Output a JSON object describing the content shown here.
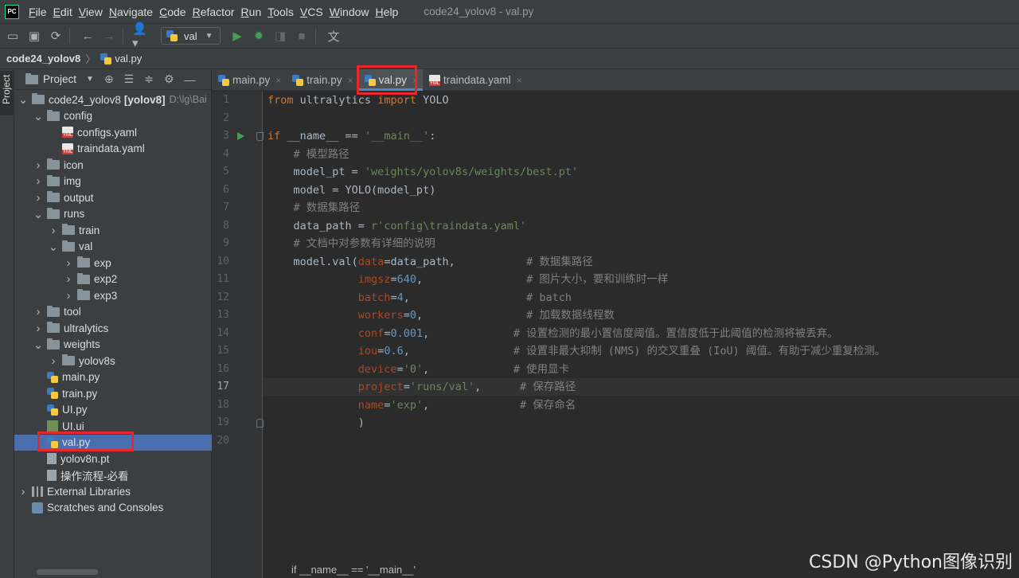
{
  "menubar": {
    "app_icon": "PC",
    "items": [
      "File",
      "Edit",
      "View",
      "Navigate",
      "Code",
      "Refactor",
      "Run",
      "Tools",
      "VCS",
      "Window",
      "Help"
    ],
    "window_title": "code24_yolov8 - val.py"
  },
  "toolbar": {
    "run_config": "val",
    "icons": [
      "open-icon",
      "save-icon",
      "sync-icon",
      "back-icon",
      "forward-icon",
      "user-icon",
      "run-icon",
      "debug-icon",
      "coverage-icon",
      "stop-icon",
      "translate-icon"
    ]
  },
  "breadcrumb": {
    "project": "code24_yolov8",
    "file": "val.py"
  },
  "toolstrip": {
    "project_tab": "Project"
  },
  "project_panel": {
    "title": "Project",
    "tree": [
      {
        "label": "code24_yolov8",
        "suffix": "[yolov8]",
        "path": "D:\\lg\\Bai",
        "type": "folder",
        "indent": 0,
        "arrow": "open"
      },
      {
        "label": "config",
        "type": "folder",
        "indent": 1,
        "arrow": "open"
      },
      {
        "label": "configs.yaml",
        "type": "yaml",
        "indent": 2,
        "arrow": "none"
      },
      {
        "label": "traindata.yaml",
        "type": "yaml",
        "indent": 2,
        "arrow": "none"
      },
      {
        "label": "icon",
        "type": "folder",
        "indent": 1,
        "arrow": "closed"
      },
      {
        "label": "img",
        "type": "folder",
        "indent": 1,
        "arrow": "closed"
      },
      {
        "label": "output",
        "type": "folder",
        "indent": 1,
        "arrow": "closed"
      },
      {
        "label": "runs",
        "type": "folder",
        "indent": 1,
        "arrow": "open"
      },
      {
        "label": "train",
        "type": "folder",
        "indent": 2,
        "arrow": "closed"
      },
      {
        "label": "val",
        "type": "folder",
        "indent": 2,
        "arrow": "open"
      },
      {
        "label": "exp",
        "type": "folder",
        "indent": 3,
        "arrow": "closed"
      },
      {
        "label": "exp2",
        "type": "folder",
        "indent": 3,
        "arrow": "closed"
      },
      {
        "label": "exp3",
        "type": "folder",
        "indent": 3,
        "arrow": "closed"
      },
      {
        "label": "tool",
        "type": "folder",
        "indent": 1,
        "arrow": "closed"
      },
      {
        "label": "ultralytics",
        "type": "folder",
        "indent": 1,
        "arrow": "closed"
      },
      {
        "label": "weights",
        "type": "folder",
        "indent": 1,
        "arrow": "open"
      },
      {
        "label": "yolov8s",
        "type": "folder",
        "indent": 2,
        "arrow": "closed"
      },
      {
        "label": "main.py",
        "type": "python",
        "indent": 1,
        "arrow": "none"
      },
      {
        "label": "train.py",
        "type": "python",
        "indent": 1,
        "arrow": "none"
      },
      {
        "label": "UI.py",
        "type": "python",
        "indent": 1,
        "arrow": "none"
      },
      {
        "label": "UI.ui",
        "type": "ui",
        "indent": 1,
        "arrow": "none"
      },
      {
        "label": "val.py",
        "type": "python",
        "indent": 1,
        "arrow": "none",
        "selected": true
      },
      {
        "label": "yolov8n.pt",
        "type": "file",
        "indent": 1,
        "arrow": "none"
      },
      {
        "label": "操作流程-必看",
        "type": "file",
        "indent": 1,
        "arrow": "none"
      },
      {
        "label": "External Libraries",
        "type": "library",
        "indent": 0,
        "arrow": "closed"
      },
      {
        "label": "Scratches and Consoles",
        "type": "scratch",
        "indent": 0,
        "arrow": "none"
      }
    ]
  },
  "tabs": [
    {
      "label": "main.py",
      "type": "python",
      "active": false
    },
    {
      "label": "train.py",
      "type": "python",
      "active": false
    },
    {
      "label": "val.py",
      "type": "python",
      "active": true
    },
    {
      "label": "traindata.yaml",
      "type": "yaml",
      "active": false
    }
  ],
  "editor": {
    "current_line": 17,
    "lines": [
      [
        [
          "kw",
          "from"
        ],
        [
          "t",
          " ultralytics "
        ],
        [
          "kw",
          "import"
        ],
        [
          "t",
          " YOLO"
        ]
      ],
      [],
      [
        [
          "kw",
          "if"
        ],
        [
          "t",
          " __name__ == "
        ],
        [
          "str",
          "'__main__'"
        ],
        [
          "t",
          ":"
        ]
      ],
      [
        [
          "t",
          "    "
        ],
        [
          "cmt",
          "# 模型路径"
        ]
      ],
      [
        [
          "t",
          "    model_pt = "
        ],
        [
          "str",
          "'weights/yolov8s/weights/best.pt'"
        ]
      ],
      [
        [
          "t",
          "    model = YOLO(model_pt)"
        ]
      ],
      [
        [
          "t",
          "    "
        ],
        [
          "cmt",
          "# 数据集路径"
        ]
      ],
      [
        [
          "t",
          "    data_path = "
        ],
        [
          "str",
          "r'config\\traindata.yaml'"
        ]
      ],
      [
        [
          "t",
          "    "
        ],
        [
          "cmt",
          "# 文档中对参数有详细的说明"
        ]
      ],
      [
        [
          "t",
          "    model.val("
        ],
        [
          "param",
          "data"
        ],
        [
          "t",
          "=data_path,           "
        ],
        [
          "cmt",
          "# 数据集路径"
        ]
      ],
      [
        [
          "t",
          "              "
        ],
        [
          "param",
          "imgsz"
        ],
        [
          "t",
          "="
        ],
        [
          "num",
          "640"
        ],
        [
          "t",
          ",                "
        ],
        [
          "cmt",
          "# 图片大小，要和训练时一样"
        ]
      ],
      [
        [
          "t",
          "              "
        ],
        [
          "param",
          "batch"
        ],
        [
          "t",
          "="
        ],
        [
          "num",
          "4"
        ],
        [
          "t",
          ",                  "
        ],
        [
          "cmt",
          "# batch"
        ]
      ],
      [
        [
          "t",
          "              "
        ],
        [
          "param",
          "workers"
        ],
        [
          "t",
          "="
        ],
        [
          "num",
          "0"
        ],
        [
          "t",
          ",                "
        ],
        [
          "cmt",
          "# 加载数据线程数"
        ]
      ],
      [
        [
          "t",
          "              "
        ],
        [
          "param",
          "conf"
        ],
        [
          "t",
          "="
        ],
        [
          "num",
          "0.001"
        ],
        [
          "t",
          ",             "
        ],
        [
          "cmt",
          "# 设置检测的最小置信度阈值。置信度低于此阈值的检测将被丢弃。"
        ]
      ],
      [
        [
          "t",
          "              "
        ],
        [
          "param",
          "iou"
        ],
        [
          "t",
          "="
        ],
        [
          "num",
          "0.6"
        ],
        [
          "t",
          ",                "
        ],
        [
          "cmt",
          "# 设置非最大抑制 (NMS) 的交叉重叠 (IoU) 阈值。有助于减少重复检测。"
        ]
      ],
      [
        [
          "t",
          "              "
        ],
        [
          "param",
          "device"
        ],
        [
          "t",
          "="
        ],
        [
          "str",
          "'0'"
        ],
        [
          "t",
          ",             "
        ],
        [
          "cmt",
          "# 使用显卡"
        ]
      ],
      [
        [
          "t",
          "              "
        ],
        [
          "param",
          "project"
        ],
        [
          "t",
          "="
        ],
        [
          "str",
          "'runs/val'"
        ],
        [
          "t",
          ",      "
        ],
        [
          "cmt",
          "# 保存路径"
        ]
      ],
      [
        [
          "t",
          "              "
        ],
        [
          "param",
          "name"
        ],
        [
          "t",
          "="
        ],
        [
          "str",
          "'exp'"
        ],
        [
          "t",
          ",              "
        ],
        [
          "cmt",
          "# 保存命名"
        ]
      ],
      [
        [
          "t",
          "              )"
        ]
      ],
      []
    ],
    "footer_breadcrumb": "if __name__ == '__main__'"
  },
  "watermark": "CSDN @Python图像识别",
  "colors": {
    "accent": "#4a88c7",
    "selection": "#4b6eaf",
    "highlight_box": "#e8262b"
  }
}
